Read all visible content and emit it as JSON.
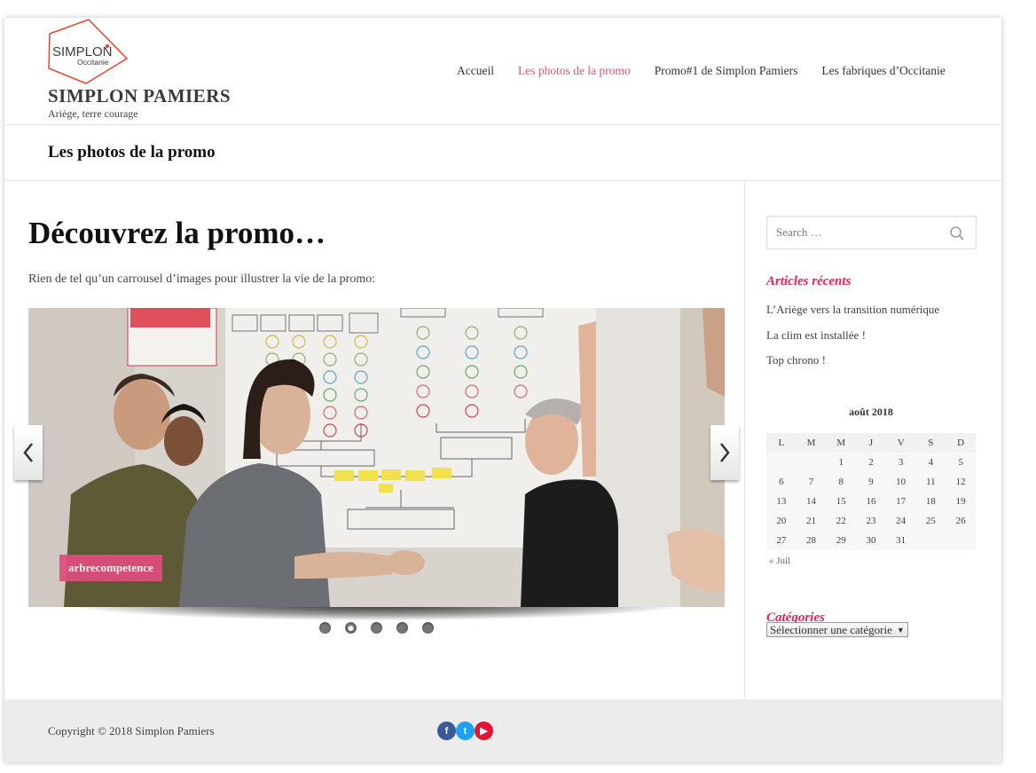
{
  "site": {
    "logo_line1": "SIMPLON",
    "logo_line2": "Occitanie",
    "title": "SIMPLON PAMIERS",
    "description": "Ariège, terre courage"
  },
  "nav": {
    "items": [
      {
        "label": "Accueil",
        "active": false
      },
      {
        "label": "Les photos de la promo",
        "active": true
      },
      {
        "label": "Promo#1 de Simplon Pamiers",
        "active": false
      },
      {
        "label": "Les fabriques d’Occitanie",
        "active": false
      }
    ]
  },
  "page": {
    "title": "Les photos de la promo",
    "heading": "Découvrez la promo…",
    "intro": "Rien de tel qu’un carrousel d’images pour illustrer la vie de la promo:"
  },
  "carousel": {
    "caption": "arbrecompetence",
    "slide_count": 5,
    "active_index": 1
  },
  "sidebar": {
    "search_placeholder": "Search …",
    "recent_title": "Articles récents",
    "recent_posts": [
      "L’Ariège vers la transition numérique",
      "La clim est installée !",
      "Top chrono !"
    ],
    "calendar": {
      "caption": "août 2018",
      "days": [
        "L",
        "M",
        "M",
        "J",
        "V",
        "S",
        "D"
      ],
      "weeks": [
        [
          "",
          "",
          "1",
          "2",
          "3",
          "4",
          "5"
        ],
        [
          "6",
          "7",
          "8",
          "9",
          "10",
          "11",
          "12"
        ],
        [
          "13",
          "14",
          "15",
          "16",
          "17",
          "18",
          "19"
        ],
        [
          "20",
          "21",
          "22",
          "23",
          "24",
          "25",
          "26"
        ],
        [
          "27",
          "28",
          "29",
          "30",
          "31",
          "",
          ""
        ]
      ],
      "prev_link": "« Juil"
    },
    "categories_title": "Catégories",
    "categories_select": "Sélectionner une catégorie"
  },
  "footer": {
    "copyright": "Copyright © 2018 Simplon Pamiers",
    "social": [
      {
        "icon": "facebook-icon",
        "glyph": "f",
        "color": "#3b5998"
      },
      {
        "icon": "twitter-icon",
        "glyph": "t",
        "color": "#1da1f2"
      },
      {
        "icon": "youtube-icon",
        "glyph": "▶",
        "color": "#e0152f"
      }
    ]
  },
  "colors": {
    "accent": "#e0245e",
    "nav_active": "#e05577",
    "caption_bg": "#e04d7d"
  }
}
